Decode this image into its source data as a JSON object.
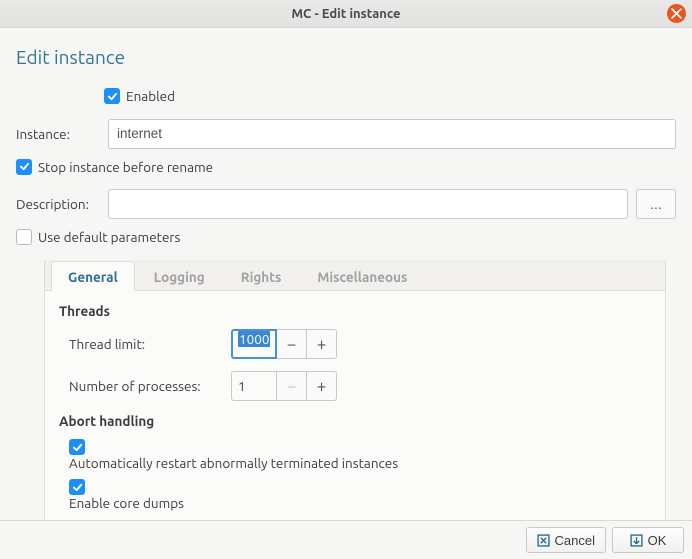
{
  "window": {
    "title": "MC - Edit instance"
  },
  "page": {
    "title": "Edit instance"
  },
  "enabled": {
    "label": "Enabled",
    "checked": true
  },
  "instance": {
    "label": "Instance:",
    "value": "internet"
  },
  "stop_before_rename": {
    "label": "Stop instance before rename",
    "checked": true
  },
  "description": {
    "label": "Description:",
    "value": "",
    "more": "..."
  },
  "default_params": {
    "label": "Use default parameters",
    "checked": false
  },
  "tabs": {
    "items": [
      "General",
      "Logging",
      "Rights",
      "Miscellaneous"
    ],
    "active": 0
  },
  "general": {
    "threads_title": "Threads",
    "thread_limit": {
      "label": "Thread limit:",
      "value": "1000"
    },
    "num_processes": {
      "label": "Number of processes:",
      "value": "1"
    },
    "abort_title": "Abort handling",
    "auto_restart": {
      "label": "Automatically restart abnormally terminated instances",
      "checked": true
    },
    "core_dumps": {
      "label": "Enable core dumps",
      "checked": true
    }
  },
  "footer": {
    "cancel": "Cancel",
    "ok": "OK"
  }
}
